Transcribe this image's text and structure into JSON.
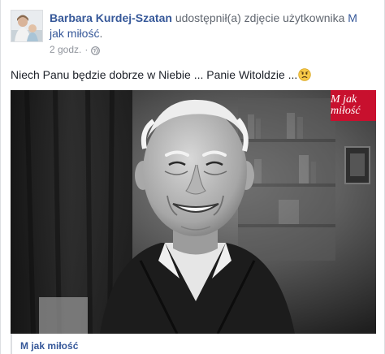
{
  "header": {
    "author": "Barbara Kurdej-Szatan",
    "action_text": "udostępnił(a) zdjęcie użytkownika",
    "shared_from": "M jak miłość",
    "trailing_punct": ".",
    "timestamp": "2 godz.",
    "separator": "·",
    "privacy_icon": "globe-icon"
  },
  "post": {
    "message": "Niech Panu będzie dobrze w Niebie ... Panie Witoldzie ...",
    "emoji_icon": "sad-face-emoji"
  },
  "photo": {
    "badge_text": "M jak miłość"
  },
  "footer": {
    "page_link": "M jak miłość"
  },
  "colors": {
    "link": "#365899",
    "text": "#1d2129",
    "meta": "#90949c",
    "badge": "#c8102e"
  }
}
